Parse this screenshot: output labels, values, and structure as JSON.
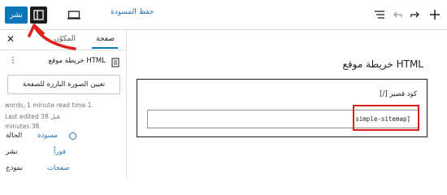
{
  "topbar": {
    "publish_label": "نشر",
    "save_draft_label": "حفظ المسودة",
    "icons": [
      "more-vertical-icon",
      "sidebar-panel-icon",
      "desktop-device-icon",
      "list-view-icon",
      "undo-icon",
      "redo-icon",
      "add-block-icon"
    ]
  },
  "sidebar": {
    "tabs": {
      "page": "صفحة",
      "block": "المكوّن"
    },
    "document_title": "خريطة موقع HTML",
    "featured_image_label": "تعيين الصورة البارزة للصفحة",
    "meta": {
      "words": "words, 1 minute read time 1.",
      "last_edited_line1": "Last edited قبل 38",
      "last_edited_line2": "minutes 38."
    },
    "properties": [
      {
        "label": "الحالة",
        "value": "مسودة"
      },
      {
        "label": "نشر",
        "value": "فوراً"
      },
      {
        "label": "نموذج",
        "value": "صفحات"
      }
    ]
  },
  "canvas": {
    "page_title": "خريطة موقع HTML",
    "shortcode_label": "كود قصير",
    "shortcode_icon_text": "[/]",
    "shortcode_value": "[simple-sitemap]"
  },
  "colors": {
    "accent": "#0c76ba",
    "annotation": "#e0201d"
  }
}
